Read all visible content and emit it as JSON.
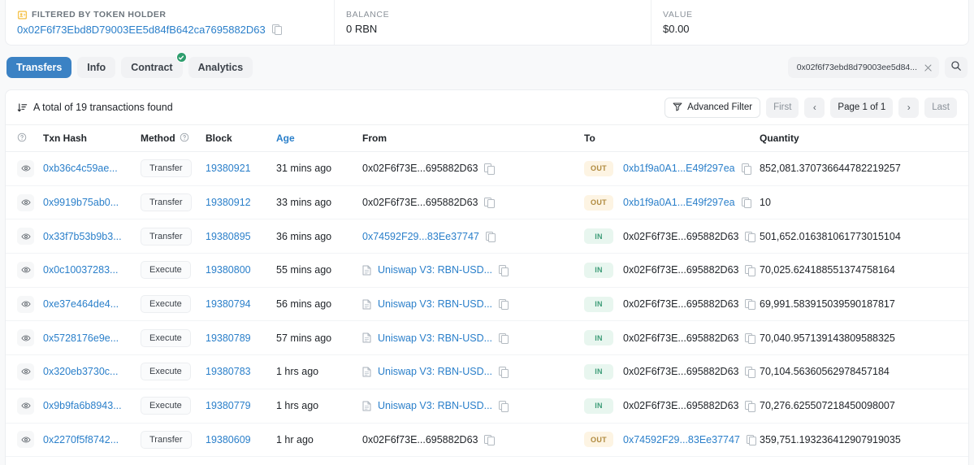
{
  "summary": {
    "filtered": {
      "label": "FILTERED BY TOKEN HOLDER",
      "icon": "address-card-icon",
      "address": "0x02F6f73Ebd8D79003EE5d84fB642ca7695882D63",
      "copy_icon": "copy-icon"
    },
    "balance": {
      "label": "BALANCE",
      "value": "0 RBN"
    },
    "value": {
      "label": "VALUE",
      "value": "$0.00"
    }
  },
  "tabs": [
    {
      "label": "Transfers",
      "active": true,
      "badge": false
    },
    {
      "label": "Info",
      "active": false,
      "badge": false
    },
    {
      "label": "Contract",
      "active": false,
      "badge": true
    },
    {
      "label": "Analytics",
      "active": false,
      "badge": false
    }
  ],
  "search": {
    "value": "0x02f6f73ebd8d79003ee5d84...",
    "clear_icon": "close-icon",
    "search_icon": "search-icon"
  },
  "toolbar": {
    "sort_icon": "sort-descending-icon",
    "total_text": "A total of 19 transactions found",
    "advanced_filter": "Advanced Filter",
    "filter_icon": "funnel-icon",
    "first": "First",
    "prev": "‹",
    "page_info": "Page 1 of 1",
    "next": "›",
    "last": "Last"
  },
  "table": {
    "columns": [
      {
        "key": "eye",
        "label": "",
        "icon": "info-circle-icon",
        "sortable": false
      },
      {
        "key": "hash",
        "label": "Txn Hash",
        "sortable": false
      },
      {
        "key": "method",
        "label": "Method",
        "icon": "info-circle-icon",
        "sortable": false
      },
      {
        "key": "block",
        "label": "Block",
        "sortable": false
      },
      {
        "key": "age",
        "label": "Age",
        "sortable": true
      },
      {
        "key": "from",
        "label": "From",
        "sortable": false
      },
      {
        "key": "to",
        "label": "To",
        "sortable": false
      },
      {
        "key": "quantity",
        "label": "Quantity",
        "sortable": false
      }
    ],
    "rows": [
      {
        "eye_icon": "eye-icon",
        "hash": "0xb36c4c59ae...",
        "method": "Transfer",
        "block": "19380921",
        "age": "31 mins ago",
        "from": {
          "text": "0x02F6f73E...695882D63",
          "style": "self",
          "contract": false
        },
        "direction": "OUT",
        "to": {
          "text": "0xb1f9a0A1...E49f297ea",
          "style": "link",
          "contract": false
        },
        "quantity": "852,081.370736644782219257"
      },
      {
        "eye_icon": "eye-icon",
        "hash": "0x9919b75ab0...",
        "method": "Transfer",
        "block": "19380912",
        "age": "33 mins ago",
        "from": {
          "text": "0x02F6f73E...695882D63",
          "style": "self",
          "contract": false
        },
        "direction": "OUT",
        "to": {
          "text": "0xb1f9a0A1...E49f297ea",
          "style": "link",
          "contract": false
        },
        "quantity": "10"
      },
      {
        "eye_icon": "eye-icon",
        "hash": "0x33f7b53b9b3...",
        "method": "Transfer",
        "block": "19380895",
        "age": "36 mins ago",
        "from": {
          "text": "0x74592F29...83Ee37747",
          "style": "link",
          "contract": false
        },
        "direction": "IN",
        "to": {
          "text": "0x02F6f73E...695882D63",
          "style": "self",
          "contract": false
        },
        "quantity": "501,652.016381061773015104"
      },
      {
        "eye_icon": "eye-icon",
        "hash": "0x0c10037283...",
        "method": "Execute",
        "block": "19380800",
        "age": "55 mins ago",
        "from": {
          "text": "Uniswap V3: RBN-USD...",
          "style": "link",
          "contract": true
        },
        "direction": "IN",
        "to": {
          "text": "0x02F6f73E...695882D63",
          "style": "self",
          "contract": false
        },
        "quantity": "70,025.624188551374758164"
      },
      {
        "eye_icon": "eye-icon",
        "hash": "0xe37e464de4...",
        "method": "Execute",
        "block": "19380794",
        "age": "56 mins ago",
        "from": {
          "text": "Uniswap V3: RBN-USD...",
          "style": "link",
          "contract": true
        },
        "direction": "IN",
        "to": {
          "text": "0x02F6f73E...695882D63",
          "style": "self",
          "contract": false
        },
        "quantity": "69,991.583915039590187817"
      },
      {
        "eye_icon": "eye-icon",
        "hash": "0x5728176e9e...",
        "method": "Execute",
        "block": "19380789",
        "age": "57 mins ago",
        "from": {
          "text": "Uniswap V3: RBN-USD...",
          "style": "link",
          "contract": true
        },
        "direction": "IN",
        "to": {
          "text": "0x02F6f73E...695882D63",
          "style": "self",
          "contract": false
        },
        "quantity": "70,040.957139143809588325"
      },
      {
        "eye_icon": "eye-icon",
        "hash": "0x320eb3730c...",
        "method": "Execute",
        "block": "19380783",
        "age": "1 hrs ago",
        "from": {
          "text": "Uniswap V3: RBN-USD...",
          "style": "link",
          "contract": true
        },
        "direction": "IN",
        "to": {
          "text": "0x02F6f73E...695882D63",
          "style": "self",
          "contract": false
        },
        "quantity": "70,104.56360562978457184"
      },
      {
        "eye_icon": "eye-icon",
        "hash": "0x9b9fa6b8943...",
        "method": "Execute",
        "block": "19380779",
        "age": "1 hrs ago",
        "from": {
          "text": "Uniswap V3: RBN-USD...",
          "style": "link",
          "contract": true
        },
        "direction": "IN",
        "to": {
          "text": "0x02F6f73E...695882D63",
          "style": "self",
          "contract": false
        },
        "quantity": "70,276.625507218450098007"
      },
      {
        "eye_icon": "eye-icon",
        "hash": "0x2270f5f8742...",
        "method": "Transfer",
        "block": "19380609",
        "age": "1 hr ago",
        "from": {
          "text": "0x02F6f73E...695882D63",
          "style": "self",
          "contract": false
        },
        "direction": "OUT",
        "to": {
          "text": "0x74592F29...83Ee37747",
          "style": "link",
          "contract": false
        },
        "quantity": "359,751.193236412907919035"
      }
    ]
  },
  "colors": {
    "accent_blue": "#2a7fca",
    "tab_active": "#3b82c4",
    "badge_in_bg": "#e8f6ef",
    "badge_in_text": "#3d9c78",
    "badge_out_bg": "#fdf4e3",
    "badge_out_text": "#b08a3e",
    "verified_green": "#2f9e6e",
    "page_bg": "#f8f9fa"
  }
}
